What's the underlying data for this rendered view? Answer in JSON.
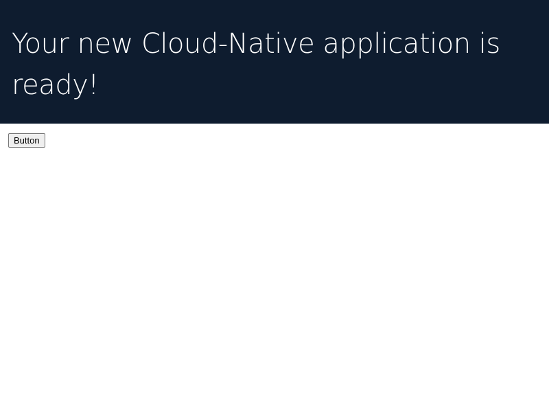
{
  "header": {
    "title": "Your new Cloud-Native application is ready!",
    "background_color": "#0e1c2f",
    "text_color": "#ffffff"
  },
  "main": {
    "button_label": "Button"
  }
}
